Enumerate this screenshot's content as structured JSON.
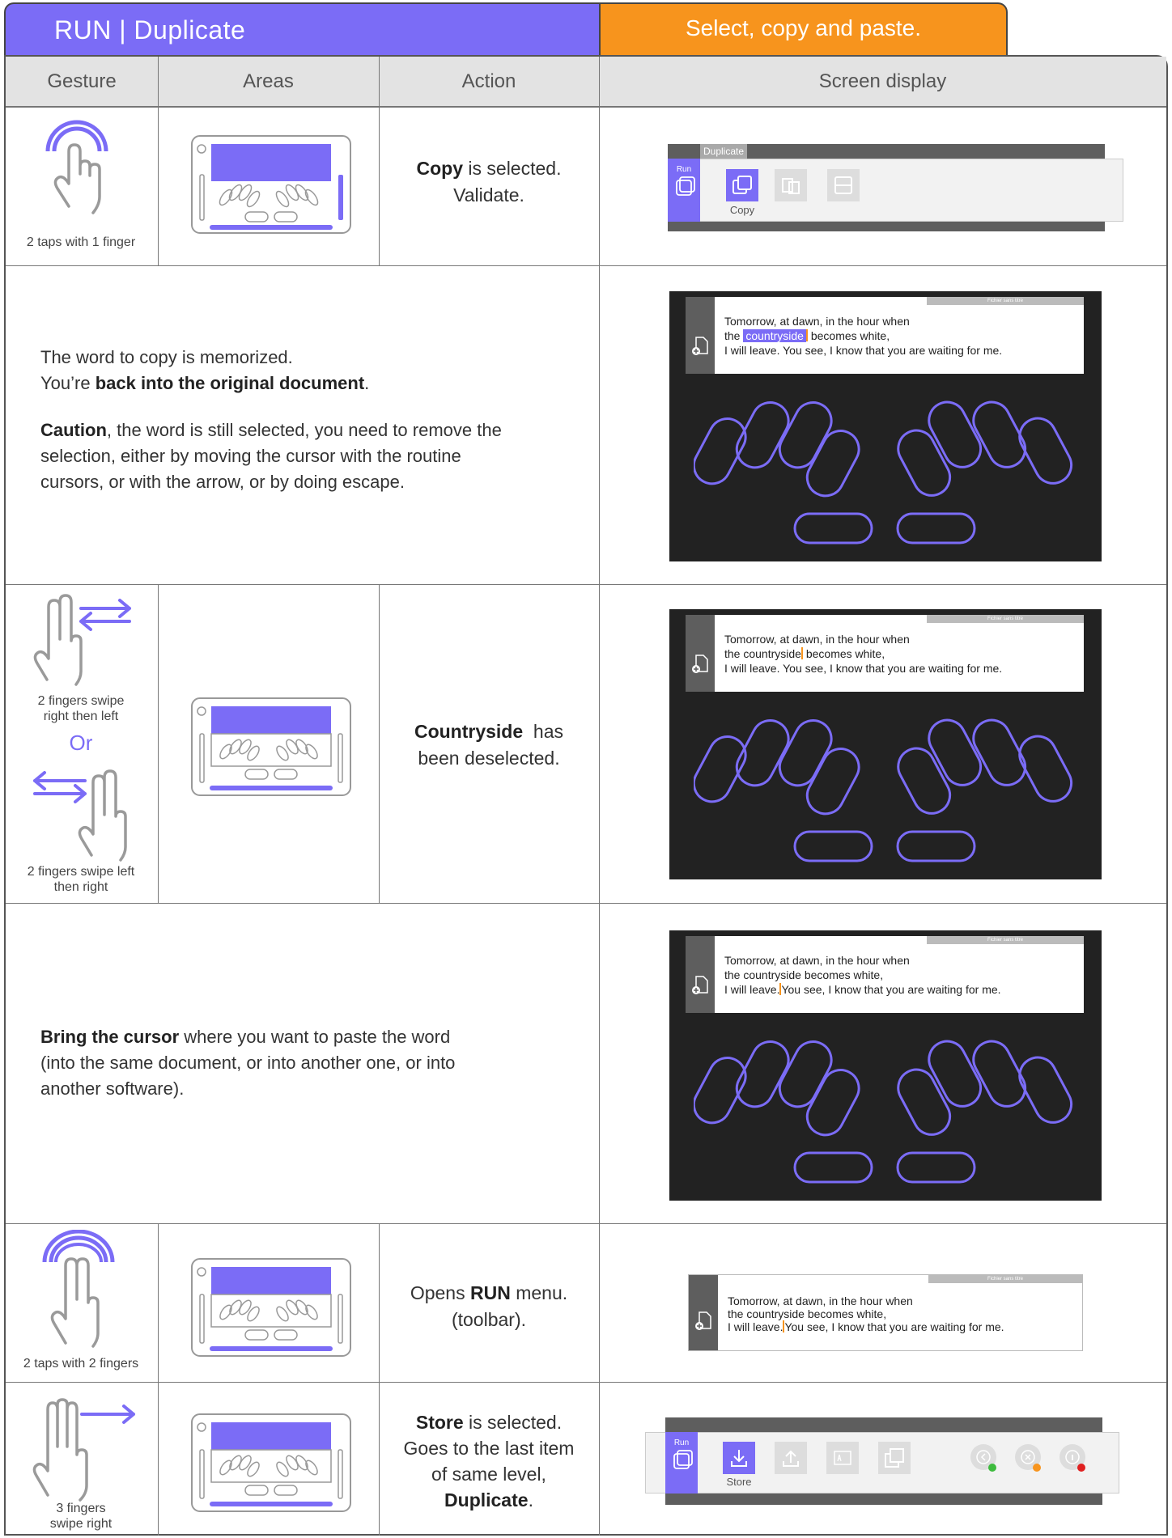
{
  "title": {
    "left": "RUN | Duplicate",
    "right": "Select, copy and paste."
  },
  "headers": {
    "gesture": "Gesture",
    "areas": "Areas",
    "action": "Action",
    "screen": "Screen display"
  },
  "rows": {
    "r1": {
      "gesture_caption": "2 taps with 1 finger",
      "action_bold": "Copy",
      "action_rest": " is selected.",
      "action_line2": "Validate.",
      "toolbar_tag": "Duplicate",
      "toolbar_run": "Run",
      "toolbar_selected": "Copy"
    },
    "r2": {
      "line1": "The word to copy is memorized.",
      "line2_pre": "You’re ",
      "line2_bold": "back into the original document",
      "line2_post": ".",
      "line3_bold": "Caution",
      "line3_rest": ", the word is still selected, you need to remove the",
      "line4": "selection, either by moving the cursor with the routine",
      "line5": "cursors, or with the arrow, or by doing escape."
    },
    "r3": {
      "caption_a": "2 fingers swipe\nright then left",
      "or": "Or",
      "caption_b": "2 fingers swipe left\nthen right",
      "action_bold": "Countryside",
      "action_rest": "  has",
      "action_line2": "been deselected."
    },
    "r4": {
      "line1_bold": "Bring the cursor",
      "line1_rest": " where you want to paste the word",
      "line2": "(into the same document, or into another one, or into",
      "line3": "another software)."
    },
    "r5": {
      "gesture_caption": "2 taps with 2 fingers",
      "action_pre": "Opens ",
      "action_bold": "RUN",
      "action_post": " menu.",
      "action_line2": "(toolbar)."
    },
    "r6": {
      "gesture_caption": "3 fingers\nswipe right",
      "action_bold1": "Store",
      "action_rest1": " is selected.",
      "action_line2": "Goes to the last item",
      "action_line3": "of same level,",
      "action_bold2": "Duplicate",
      "action_end": ".",
      "toolbar_run": "Run",
      "toolbar_selected": "Store"
    }
  },
  "doc": {
    "bar_label": "Fichier sans titre",
    "line1": "Tomorrow, at dawn, in the hour when",
    "line2_pre": "the ",
    "line2_word": "countryside",
    "line2_post": " becomes white,",
    "line2_full": "the countryside becomes white,",
    "line3_a": "I will leave.",
    "line3_b": "You see, I know that you are waiting for me.",
    "line3_full": "I will leave. You see, I know that you are waiting for me."
  },
  "colors": {
    "accent": "#7b6cf6",
    "orange": "#f7941d",
    "screen_bg": "#222222",
    "header_bg": "#e3e3e3"
  }
}
